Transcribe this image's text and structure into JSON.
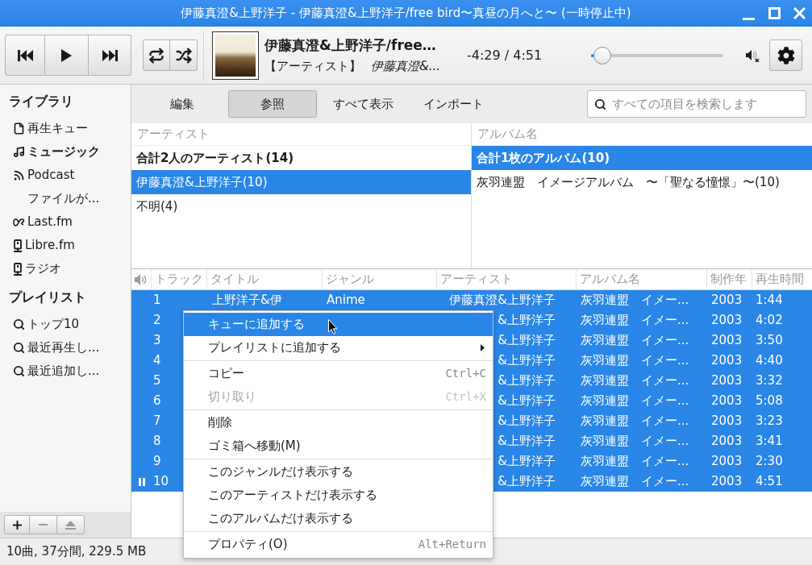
{
  "window": {
    "title": "伊藤真澄&上野洋子 - 伊藤真澄&上野洋子/free bird〜真昼の月へと〜 (一時停止中)"
  },
  "player": {
    "playing": false,
    "track_title": "伊藤真澄&上野洋子/free…",
    "artist_label": "【アーティスト】",
    "artist": "伊藤真澄&...",
    "time": "-4:29 / 4:51",
    "seek": {
      "level": 0.02
    },
    "muted": true
  },
  "sidebar": {
    "sections": [
      {
        "heading": "ライブラリ",
        "items": [
          {
            "label": "再生キュー",
            "kind": "queue",
            "selected": false
          },
          {
            "label": "ミュージック",
            "kind": "music",
            "selected": true
          },
          {
            "label": "Podcast",
            "kind": "podcast",
            "selected": false,
            "children": [
              {
                "label": "ファイルが...",
                "selected": false
              }
            ]
          },
          {
            "label": "Last.fm",
            "kind": "loop",
            "selected": false
          },
          {
            "label": "Libre.fm",
            "kind": "device",
            "selected": false
          },
          {
            "label": "ラジオ",
            "kind": "device",
            "selected": false
          }
        ]
      },
      {
        "heading": "プレイリスト",
        "items": [
          {
            "label": "トップ10",
            "kind": "smart",
            "selected": false
          },
          {
            "label": "最近再生し...",
            "kind": "smart",
            "selected": false
          },
          {
            "label": "最近追加し...",
            "kind": "smart",
            "selected": false
          }
        ]
      }
    ],
    "buttons": [
      {
        "kind": "add",
        "disabled": false
      },
      {
        "kind": "remove",
        "disabled": true
      },
      {
        "kind": "eject",
        "disabled": true
      }
    ]
  },
  "tabs": [
    {
      "label": "編集",
      "selected": false
    },
    {
      "label": "参照",
      "selected": true
    },
    {
      "label": "すべて表示",
      "selected": false
    },
    {
      "label": "インポート",
      "selected": false
    }
  ],
  "search": {
    "placeholder": "すべての項目を検索します"
  },
  "browser": {
    "panes": [
      {
        "header": "アーティスト",
        "items": [
          {
            "label": "合計2人のアーティスト(14)",
            "kind": "total",
            "selected": false
          },
          {
            "label": "伊藤真澄&上野洋子(10)",
            "kind": "entry",
            "selected": true
          },
          {
            "label": "不明(4)",
            "kind": "entry",
            "selected": false
          }
        ]
      },
      {
        "header": "アルバム名",
        "items": [
          {
            "label": "合計1枚のアルバム(10)",
            "kind": "total",
            "selected": true
          },
          {
            "label": "灰羽連盟　イメージアルバム　〜「聖なる憧憬」〜(10)",
            "kind": "entry",
            "selected": false
          }
        ]
      }
    ]
  },
  "tracks": {
    "columns": [
      "トラック",
      "タイトル",
      "ジャンル",
      "アーティスト",
      "アルバム名",
      "制作年",
      "再生時間"
    ],
    "rows": [
      {
        "track": "1",
        "title": "上野洋子&伊",
        "genre": "Anime",
        "artist": "伊藤真澄&上野洋子",
        "album": "灰羽連盟　イメー...",
        "year": "2003",
        "time": "1:44",
        "selected": true,
        "paused": false
      },
      {
        "track": "2",
        "artist": "&上野洋子",
        "album": "灰羽連盟　イメー...",
        "year": "2003",
        "time": "4:02",
        "selected": true,
        "paused": false
      },
      {
        "track": "3",
        "artist": "&上野洋子",
        "album": "灰羽連盟　イメー...",
        "year": "2003",
        "time": "3:50",
        "selected": true,
        "paused": false
      },
      {
        "track": "4",
        "artist": "&上野洋子",
        "album": "灰羽連盟　イメー...",
        "year": "2003",
        "time": "4:40",
        "selected": true,
        "paused": false
      },
      {
        "track": "5",
        "artist": "&上野洋子",
        "album": "灰羽連盟　イメー...",
        "year": "2003",
        "time": "3:32",
        "selected": true,
        "paused": false
      },
      {
        "track": "6",
        "artist": "&上野洋子",
        "album": "灰羽連盟　イメー...",
        "year": "2003",
        "time": "5:08",
        "selected": true,
        "paused": false
      },
      {
        "track": "7",
        "artist": "&上野洋子",
        "album": "灰羽連盟　イメー...",
        "year": "2003",
        "time": "3:23",
        "selected": true,
        "paused": false
      },
      {
        "track": "8",
        "artist": "&上野洋子",
        "album": "灰羽連盟　イメー...",
        "year": "2003",
        "time": "3:41",
        "selected": true,
        "paused": false
      },
      {
        "track": "9",
        "artist": "&上野洋子",
        "album": "灰羽連盟　イメー...",
        "year": "2003",
        "time": "2:30",
        "selected": true,
        "paused": false
      },
      {
        "track": "10",
        "artist": "&上野洋子",
        "album": "灰羽連盟　イメー...",
        "year": "2003",
        "time": "4:51",
        "selected": true,
        "paused": true
      }
    ]
  },
  "context_menu": {
    "groups": [
      {
        "items": [
          {
            "label": "キューに追加する",
            "selected": true,
            "disabled": false,
            "submenu": false
          },
          {
            "label": "プレイリストに追加する",
            "selected": false,
            "disabled": false,
            "submenu": true
          }
        ]
      },
      {
        "items": [
          {
            "label": "コピー",
            "shortcut": "Ctrl+C",
            "selected": false,
            "disabled": false,
            "submenu": false
          },
          {
            "label": "切り取り",
            "shortcut": "Ctrl+X",
            "selected": false,
            "disabled": true,
            "submenu": false
          }
        ]
      },
      {
        "items": [
          {
            "label": "削除",
            "selected": false,
            "disabled": false,
            "submenu": false
          },
          {
            "label": "ゴミ箱へ移動(M)",
            "selected": false,
            "disabled": false,
            "submenu": false
          }
        ]
      },
      {
        "items": [
          {
            "label": "このジャンルだけ表示する",
            "selected": false,
            "disabled": false,
            "submenu": false
          },
          {
            "label": "このアーティストだけ表示する",
            "selected": false,
            "disabled": false,
            "submenu": false
          },
          {
            "label": "このアルバムだけ表示する",
            "selected": false,
            "disabled": false,
            "submenu": false
          }
        ]
      },
      {
        "items": [
          {
            "label": "プロパティ(O)",
            "shortcut": "Alt+Return",
            "selected": false,
            "disabled": false,
            "submenu": false
          }
        ]
      }
    ]
  },
  "status_bar": {
    "text": "10曲, 37分間, 229.5 MB"
  }
}
